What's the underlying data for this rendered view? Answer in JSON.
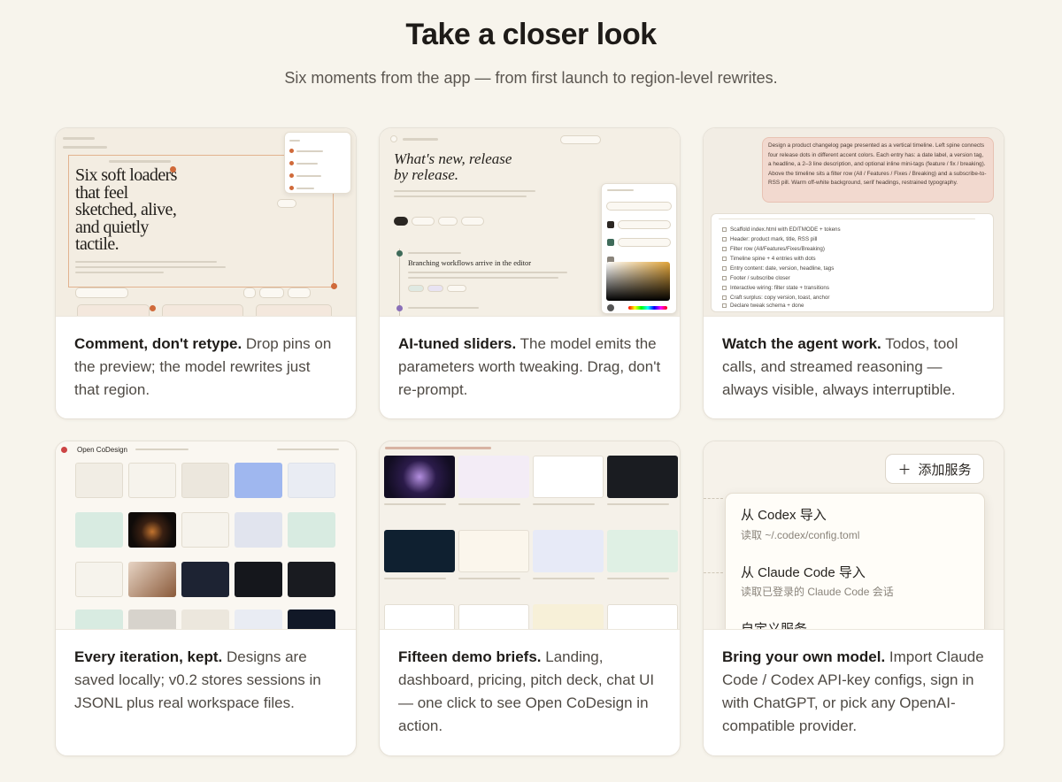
{
  "header": {
    "title": "Take a closer look",
    "subtitle": "Six moments from the app — from first launch to region-level rewrites."
  },
  "cards": [
    {
      "title": "Comment, don't retype.",
      "body": " Drop pins on the preview; the model rewrites just that region.",
      "thumb": {
        "headline": "Six soft loaders that feel sketched, alive, and quietly tactile."
      }
    },
    {
      "title": "AI-tuned sliders.",
      "body": " The model emits the parameters worth tweaking. Drag, don't re-prompt.",
      "thumb": {
        "hero": "What's new, release by release.",
        "entry": "Branching workflows arrive in the editor"
      }
    },
    {
      "title": "Watch the agent work.",
      "body": " Todos, tool calls, and streamed reasoning — always visible, always interruptible.",
      "thumb": {
        "prompt": "Design a product changelog page presented as a vertical timeline. Left spine connects four release dots in different accent colors. Each entry has: a date label, a version tag, a headline, a 2–3 line description, and optional inline mini-tags (feature / fix / breaking). Above the timeline sits a filter row (All / Features / Fixes / Breaking) and a subscribe-to-RSS pill. Warm off-white background, serif headings, restrained typography.",
        "todos": [
          "Scaffold index.html with EDITMODE + tokens",
          "Header: product mark, title, RSS pill",
          "Filter row (All/Features/Fixes/Breaking)",
          "Timeline spine + 4 entries with dots",
          "Entry content: date, version, headline, tags",
          "Footer / subscribe closer",
          "Interactive wiring: filter state + transitions",
          "Craft surplus: copy version, toast, anchor",
          "Declare tweak schema + done"
        ]
      }
    },
    {
      "title": "Every iteration, kept.",
      "body": " Designs are saved locally; v0.2 stores sessions in JSONL plus real workspace files.",
      "thumb": {
        "brand": "Open CoDesign"
      }
    },
    {
      "title": "Fifteen demo briefs.",
      "body": " Landing, dashboard, pricing, pitch deck, chat UI — one click to see Open CoDesign in action.",
      "thumb": {}
    },
    {
      "title": "Bring your own model.",
      "body": " Import Claude Code / Codex API-key configs, sign in with ChatGPT, or pick any OpenAI-compatible provider.",
      "thumb": {
        "add_button": "添加服务",
        "options": [
          {
            "label": "从 Codex 导入",
            "sub": "读取 ~/.codex/config.toml"
          },
          {
            "label": "从 Claude Code 导入",
            "sub": "读取已登录的 Claude Code 会话"
          },
          {
            "label": "自定义服务",
            "sub": ""
          }
        ]
      }
    }
  ]
}
